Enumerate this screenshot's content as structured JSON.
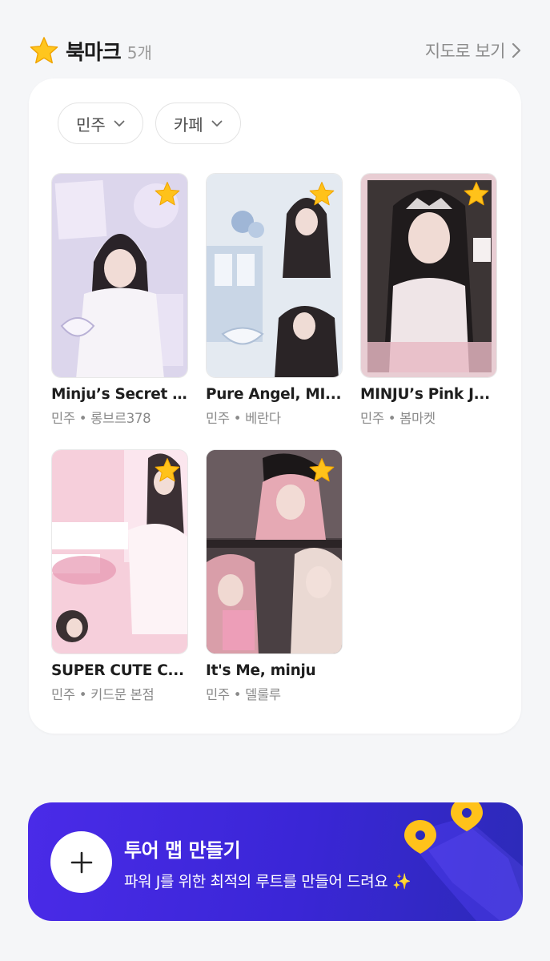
{
  "header": {
    "title": "북마크",
    "count": "5개",
    "map_link": "지도로 보기"
  },
  "filters": [
    {
      "label": "민주"
    },
    {
      "label": "카페"
    }
  ],
  "bookmarks": [
    {
      "title": "Minju’s Secret ...",
      "subtitle": "민주 • 롱브르378",
      "starred": true,
      "palette": [
        "#d9d3ea",
        "#efe9f7",
        "#b9b1d6"
      ]
    },
    {
      "title": "Pure Angel, MI...",
      "subtitle": "민주 • 베란다",
      "starred": true,
      "palette": [
        "#dfe6ef",
        "#f4f6fa",
        "#aebfd6"
      ]
    },
    {
      "title": "MINJU’s Pink J...",
      "subtitle": "민주 • 봄마켓",
      "starred": true,
      "palette": [
        "#3a3434",
        "#e7c9cf",
        "#6b5a5d"
      ]
    },
    {
      "title": "SUPER CUTE C...",
      "subtitle": "민주 • 키드문 본점",
      "starred": true,
      "palette": [
        "#f5c9d6",
        "#fde9ef",
        "#e79ab2"
      ]
    },
    {
      "title": "It's Me, minju",
      "subtitle": "민주 • 델룰루",
      "starred": true,
      "palette": [
        "#4a3f42",
        "#e7b3bd",
        "#b58b93"
      ]
    }
  ],
  "banner": {
    "title": "투어 맵 만들기",
    "subtitle": "파워 J를 위한 최적의 루트를 만들어 드려요 ✨"
  },
  "colors": {
    "star": "#ffc21a",
    "banner": "#3a26d6",
    "pin": "#ffc21a"
  }
}
